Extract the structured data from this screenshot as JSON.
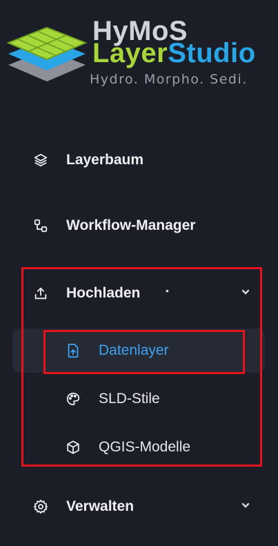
{
  "logo": {
    "title_line1": "HyMoS",
    "title_layer": "Layer",
    "title_studio": "Studio",
    "tagline": "Hydro. Morpho. Sedi."
  },
  "nav": {
    "layerbaum": "Layerbaum",
    "workflow": "Workflow-Manager",
    "hochladen": "Hochladen",
    "hochladen_dot": "•",
    "sub": {
      "datenlayer": "Datenlayer",
      "sld": "SLD-Stile",
      "qgis": "QGIS-Modelle"
    },
    "verwalten": "Verwalten"
  },
  "colors": {
    "background": "#1b1e26",
    "active_text": "#3ea1f2",
    "highlight_border": "#e8121c",
    "logo_green": "#a7d53a",
    "logo_blue": "#28a6e8"
  },
  "icons": {
    "layerbaum": "layers-icon",
    "workflow": "workflow-icon",
    "hochladen": "upload-icon",
    "datenlayer": "file-upload-icon",
    "sld": "palette-icon",
    "qgis": "cube-icon",
    "verwalten": "gear-icon",
    "expand": "chevron-down-icon"
  }
}
